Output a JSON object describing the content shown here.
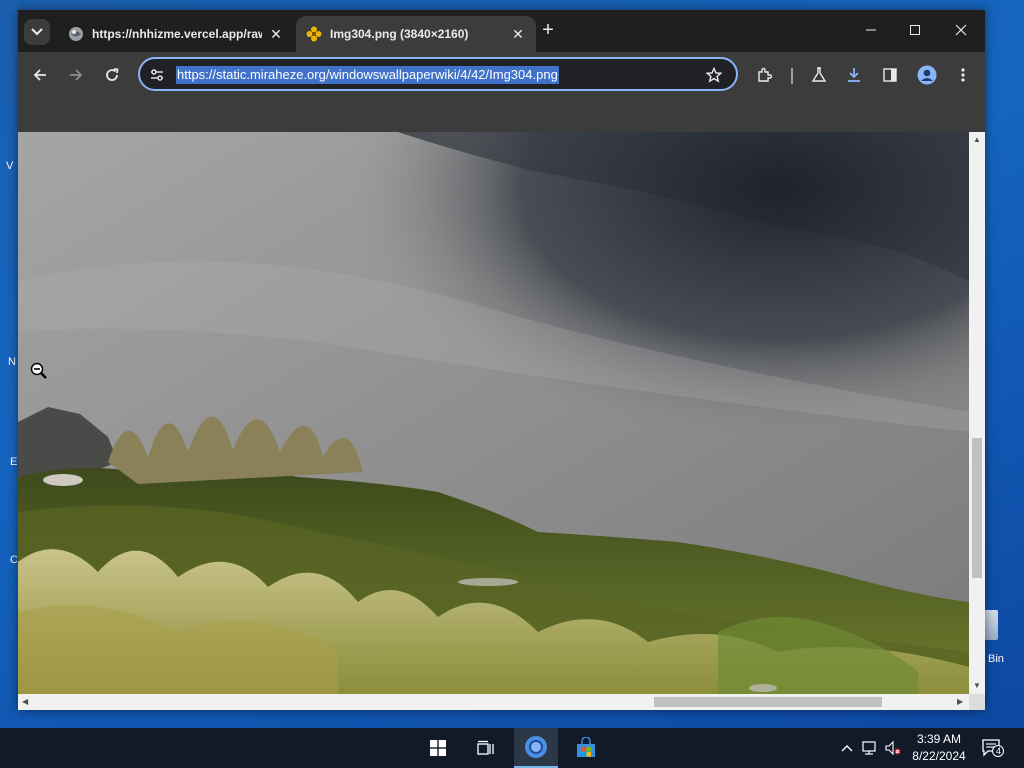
{
  "desktop": {
    "fragments": [
      "V",
      "N",
      "E",
      "C"
    ],
    "recycle_bin_label": "Bin"
  },
  "browser": {
    "tabs": [
      {
        "title": "https://nhhizme.vercel.app/raw",
        "favicon": "globe-icon",
        "active": false
      },
      {
        "title": "Img304.png (3840×2160)",
        "favicon": "image-favicon-icon",
        "active": true
      }
    ],
    "address": "https://static.miraheze.org/windowswallpaperwiki/4/42/Img304.png"
  },
  "taskbar": {
    "time": "3:39 AM",
    "date": "8/22/2024",
    "notification_count": "4"
  },
  "colors": {
    "accent": "#8ab4f8",
    "url_highlight": "#3f72c8",
    "taskbar": "#101a29"
  }
}
